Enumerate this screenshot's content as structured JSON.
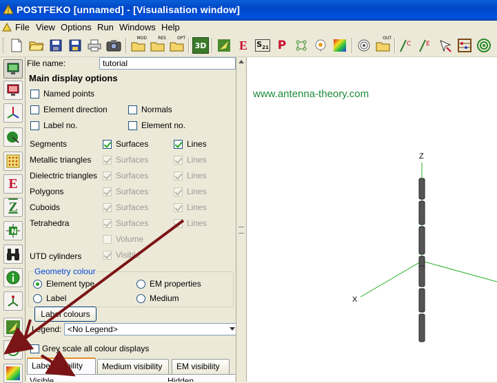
{
  "window": {
    "title": "POSTFEKO [unnamed] - [Visualisation window]"
  },
  "menu": [
    "File",
    "View",
    "Options",
    "Run",
    "Windows",
    "Help"
  ],
  "toolbar": {
    "mod_label": "MOD",
    "res_label": "RES",
    "opt_label": "OPT",
    "out_label": "OUT",
    "three_d_label": "3D",
    "e_label": "E",
    "s21_label": "S21",
    "p_label": "P"
  },
  "sidebar": {
    "e_label": "E",
    "z_label": "Z",
    "n_label": "N"
  },
  "panel": {
    "file_name_label": "File name:",
    "file_name_value": "tutorial",
    "main_heading": "Main display options",
    "named_points": "Named points",
    "element_direction": "Element direction",
    "normals": "Normals",
    "label_no": "Label no.",
    "element_no": "Element no.",
    "rows": [
      {
        "name": "Segments",
        "surfaces": "Surfaces",
        "lines": "Lines"
      },
      {
        "name": "Metallic triangles",
        "surfaces": "Surfaces",
        "lines": "Lines"
      },
      {
        "name": "Dielectric triangles",
        "surfaces": "Surfaces",
        "lines": "Lines"
      },
      {
        "name": "Polygons",
        "surfaces": "Surfaces",
        "lines": "Lines"
      },
      {
        "name": "Cuboids",
        "surfaces": "Surfaces",
        "lines": "Lines"
      },
      {
        "name": "Tetrahedra",
        "surfaces": "Surfaces",
        "lines": "Lines"
      }
    ],
    "volume": "Volume",
    "utd_cylinders": "UTD cylinders",
    "visible": "Visible",
    "geometry_colour_title": "Geometry colour",
    "element_type": "Element type",
    "em_properties": "EM properties",
    "label": "Label",
    "medium": "Medium",
    "label_colours_button": "Label colours",
    "legend_label": "Legend:",
    "legend_value": "<No Legend>",
    "grey_scale": "Grey scale all colour displays",
    "tabs": [
      "Label visibility",
      "Medium visibility",
      "EM visibility"
    ],
    "col_visible": "Visible",
    "col_hidden": "Hidden"
  },
  "viewport": {
    "watermark": "www.antenna-theory.com",
    "axis_z": "Z",
    "axis_x": "X"
  },
  "colors": {
    "accent": "#0054e3",
    "arrow": "#7b1416",
    "watermark": "#1e8a3c",
    "axis_green": "#21b021"
  }
}
